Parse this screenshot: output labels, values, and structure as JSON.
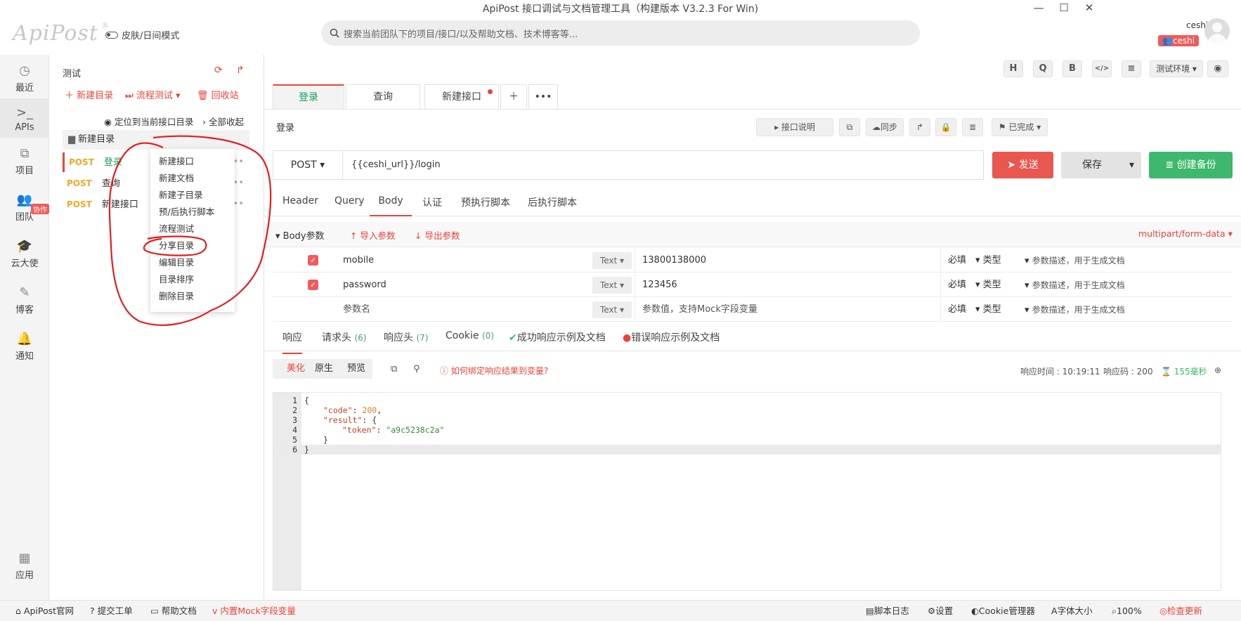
{
  "window": {
    "title": "ApiPost 接口调试与文档管理工具（构建版本 V3.2.3 For Win)",
    "minimize_icon": "minimize-icon",
    "maximize_icon": "maximize-icon",
    "close_icon": "close-icon"
  },
  "header": {
    "logo_text": "ApiPost",
    "logo_reg": "®",
    "skin_toggle_label": "皮肤/日间模式",
    "search_placeholder": "搜索当前团队下的项目/接口/以及帮助文档、技术博客等...",
    "user_name": "ceshi",
    "team_badge": "ceshi"
  },
  "left_rail": {
    "items": [
      {
        "label": "最近",
        "icon": "clock-icon"
      },
      {
        "label": "APIs",
        "icon": "terminal-icon"
      },
      {
        "label": "项目",
        "icon": "project-icon"
      },
      {
        "label": "团队",
        "icon": "team-icon"
      },
      {
        "label": "云大使",
        "icon": "graduation-cap-icon"
      },
      {
        "label": "博客",
        "icon": "edit-icon"
      },
      {
        "label": "通知",
        "icon": "bell-icon"
      },
      {
        "label": "应用",
        "icon": "grid-icon"
      }
    ],
    "collab_badge": "协作"
  },
  "tree": {
    "project_name": "测试",
    "new_folder": "新建目录",
    "flow_test": "流程测试",
    "recycle_bin": "回收站",
    "locate_current": "定位到当前接口目录",
    "collapse_all": "全部收起",
    "folder_name": "新建目录",
    "apis": [
      {
        "method": "POST",
        "name": "登录"
      },
      {
        "method": "POST",
        "name": "查询"
      },
      {
        "method": "POST",
        "name": "新建接口"
      }
    ]
  },
  "context_menu": {
    "items": [
      "新建接口",
      "新建文档",
      "新建子目录",
      "预/后执行脚本",
      "流程测试",
      "分享目录",
      "编辑目录",
      "目录排序",
      "删除目录"
    ]
  },
  "toolbar": {
    "buttons": [
      "H",
      "Q",
      "B",
      "</>",
      "≡"
    ],
    "env_select": "测试环境"
  },
  "tabs": [
    {
      "label": "登录"
    },
    {
      "label": "查询"
    },
    {
      "label": "新建接口"
    }
  ],
  "api": {
    "name": "登录",
    "doc_btn": "接口说明",
    "sync_btn": "同步",
    "status_btn": "已完成",
    "method": "POST",
    "url": "{{ceshi_url}}/login",
    "send_label": "发送",
    "save_label": "保存",
    "backup_label": "创建备份"
  },
  "request_tabs": [
    "Header",
    "Query",
    "Body",
    "认证",
    "预执行脚本",
    "后执行脚本"
  ],
  "body": {
    "section_label": "Body参数",
    "import_label": "导入参数",
    "export_label": "导出参数",
    "content_type": "multipart/form-data",
    "params": [
      {
        "key": "mobile",
        "type": "Text",
        "value": "13800138000",
        "required": "必填",
        "datatype": "类型",
        "desc": "参数描述，用于生成文档"
      },
      {
        "key": "password",
        "type": "Text",
        "value": "123456",
        "required": "必填",
        "datatype": "类型",
        "desc": "参数描述，用于生成文档"
      },
      {
        "key": "参数名",
        "type": "Text",
        "value": "参数值，支持Mock字段变量",
        "required": "必填",
        "datatype": "类型",
        "desc": "参数描述，用于生成文档"
      }
    ]
  },
  "response_tabs": {
    "response": "响应",
    "req_headers": "请求头",
    "req_headers_count": "(6)",
    "resp_headers": "响应头",
    "resp_headers_count": "(7)",
    "cookie": "Cookie",
    "cookie_count": "(0)",
    "success_example": "成功响应示例及文档",
    "error_example": "错误响应示例及文档"
  },
  "response_bar": {
    "formats": [
      "美化",
      "原生",
      "预览"
    ],
    "bind_hint": "如何绑定响应结果到变量?",
    "time_label": "响应时间 : 10:19:11",
    "code_label": "响应码 : 200",
    "duration": "155毫秒"
  },
  "response_body": {
    "lines": [
      {
        "no": "1",
        "text": "{"
      },
      {
        "no": "2",
        "key": "\"code\"",
        "sep": ": ",
        "val": "200",
        "tail": ","
      },
      {
        "no": "3",
        "key": "\"result\"",
        "sep": ": ",
        "tail": "{"
      },
      {
        "no": "4",
        "key": "\"token\"",
        "sep": ": ",
        "str": "\"a9c5238c2a\""
      },
      {
        "no": "5",
        "text": "}"
      },
      {
        "no": "6",
        "text": "}"
      }
    ]
  },
  "status_bar": {
    "official_site": "ApiPost官网",
    "submit_ticket": "提交工单",
    "help_docs": "帮助文档",
    "mock_vars": "内置Mock字段变量",
    "script_log": "脚本日志",
    "settings": "设置",
    "cookie_manager": "Cookie管理器",
    "font_size": "字体大小",
    "zoom": "100%",
    "check_update": "检查更新"
  },
  "colors": {
    "accent": "#e8443a",
    "send": "#e8584f",
    "backup": "#3db86c",
    "method_post": "#f5a623",
    "annotation": "#e51d1d"
  }
}
